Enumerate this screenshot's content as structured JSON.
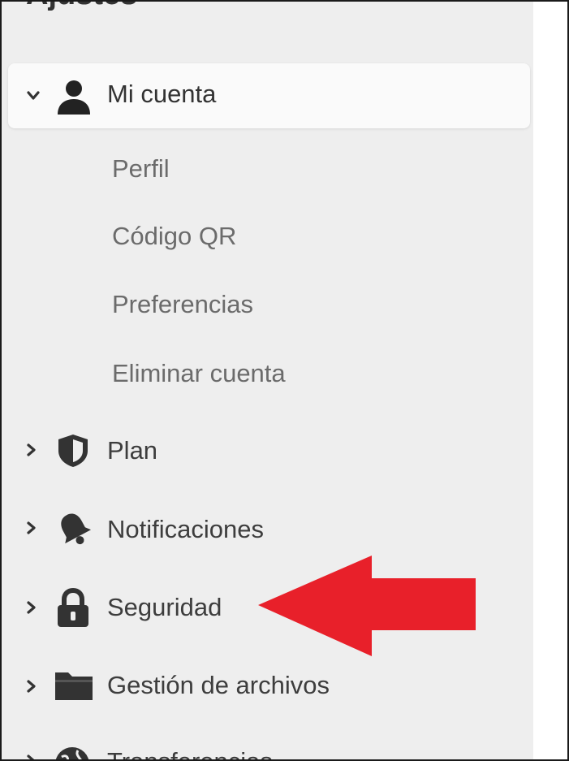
{
  "page": {
    "heading": "Ajustes"
  },
  "menu": {
    "account": {
      "label": "Mi cuenta",
      "icon": "user-icon",
      "expanded": true,
      "subitems": [
        "Perfil",
        "Código QR",
        "Preferencias",
        "Eliminar cuenta"
      ]
    },
    "plan": {
      "label": "Plan",
      "icon": "shield-icon"
    },
    "notifications": {
      "label": "Notificaciones",
      "icon": "bell-icon"
    },
    "security": {
      "label": "Seguridad",
      "icon": "lock-icon"
    },
    "files": {
      "label": "Gestión de archivos",
      "icon": "folder-icon"
    },
    "transfers": {
      "label": "Transferencias",
      "icon": "globe-icon"
    }
  },
  "annotation": {
    "type": "red-arrow",
    "color": "#e8202a",
    "points_to": "Seguridad"
  },
  "colors": {
    "sidebar_bg": "#eeeeee",
    "active_bg": "#fafafa",
    "text_main": "#3d3d3d",
    "text_sub": "#6b6b6b",
    "icon": "#333333"
  }
}
